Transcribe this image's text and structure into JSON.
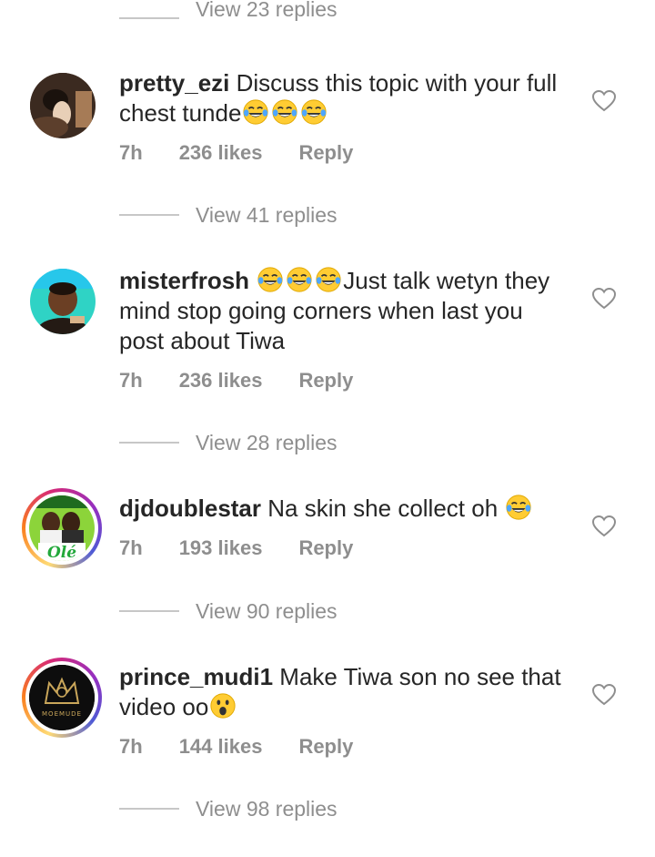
{
  "top": {
    "view_replies": "View 23 replies"
  },
  "comments": [
    {
      "username": "pretty_ezi",
      "text_before": "Discuss this topic with your full chest tunde",
      "time": "7h",
      "likes": "236 likes",
      "reply": "Reply",
      "view_replies": "View 41 replies"
    },
    {
      "username": "misterfrosh",
      "text_after": "Just talk wetyn they mind stop going corners when last you post about Tiwa",
      "time": "7h",
      "likes": "236 likes",
      "reply": "Reply",
      "view_replies": "View 28 replies"
    },
    {
      "username": "djdoublestar",
      "text_before": "Na skin she collect oh",
      "avatar_text": "Olé",
      "time": "7h",
      "likes": "193 likes",
      "reply": "Reply",
      "view_replies": "View 90 replies"
    },
    {
      "username": "prince_mudi1",
      "text_before": "Make Tiwa son no see that video oo",
      "avatar_text": "MOEMUDE",
      "time": "7h",
      "likes": "144 likes",
      "reply": "Reply",
      "view_replies": "View 98 replies"
    }
  ],
  "colors": {
    "text": "#262626",
    "muted": "#8e8e8e",
    "line": "#c7c7c7"
  }
}
